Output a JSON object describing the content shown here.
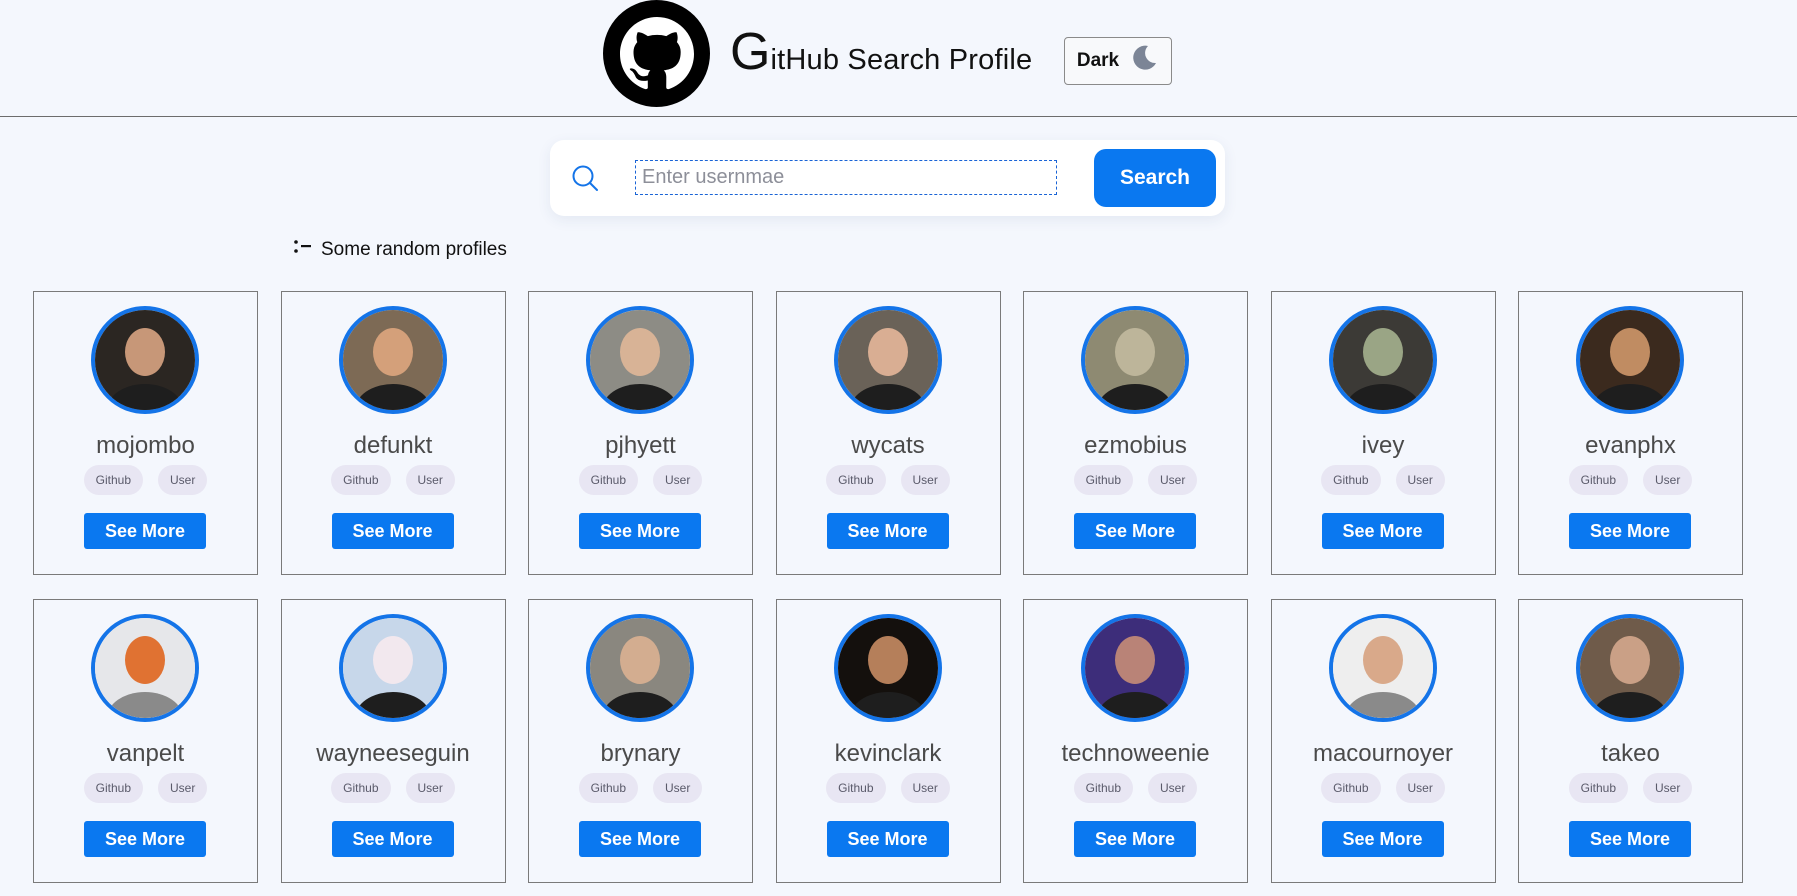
{
  "header": {
    "logo_icon": "github-octocat-icon",
    "title_first": "G",
    "title_rest": "itHub Search Profile",
    "theme_button_label": "Dark",
    "theme_icon": "moon-icon"
  },
  "search": {
    "icon": "search-icon",
    "placeholder": "Enter usernmae",
    "value": "",
    "button_label": "Search"
  },
  "random": {
    "icon": "list-icon",
    "label": "Some random profiles"
  },
  "colors": {
    "accent": "#0a78f0",
    "avatar_ring": "#1474e8",
    "badge_bg": "#e8e6f3",
    "page_bg": "#f4f7fd"
  },
  "profiles": [
    {
      "username": "mojombo",
      "badges": [
        "Github",
        "User"
      ],
      "button": "See More",
      "avatar_bg": "#2b2622",
      "avatar_fg": "#c79778"
    },
    {
      "username": "defunkt",
      "badges": [
        "Github",
        "User"
      ],
      "button": "See More",
      "avatar_bg": "#7d6a55",
      "avatar_fg": "#d4a07a"
    },
    {
      "username": "pjhyett",
      "badges": [
        "Github",
        "User"
      ],
      "button": "See More",
      "avatar_bg": "#8d8c85",
      "avatar_fg": "#d8b396"
    },
    {
      "username": "wycats",
      "badges": [
        "Github",
        "User"
      ],
      "button": "See More",
      "avatar_bg": "#6a6258",
      "avatar_fg": "#d9ae93"
    },
    {
      "username": "ezmobius",
      "badges": [
        "Github",
        "User"
      ],
      "button": "See More",
      "avatar_bg": "#8e8a72",
      "avatar_fg": "#bdb59a"
    },
    {
      "username": "ivey",
      "badges": [
        "Github",
        "User"
      ],
      "button": "See More",
      "avatar_bg": "#3c3a36",
      "avatar_fg": "#9aa585"
    },
    {
      "username": "evanphx",
      "badges": [
        "Github",
        "User"
      ],
      "button": "See More",
      "avatar_bg": "#3b2a1e",
      "avatar_fg": "#c08c62"
    },
    {
      "username": "vanpelt",
      "badges": [
        "Github",
        "User"
      ],
      "button": "See More",
      "avatar_bg": "#e6e7ea",
      "avatar_fg": "#e07232"
    },
    {
      "username": "wayneeseguin",
      "badges": [
        "Github",
        "User"
      ],
      "button": "See More",
      "avatar_bg": "#c7d7ea",
      "avatar_fg": "#f2e8ee"
    },
    {
      "username": "brynary",
      "badges": [
        "Github",
        "User"
      ],
      "button": "See More",
      "avatar_bg": "#8a877f",
      "avatar_fg": "#d3ad90"
    },
    {
      "username": "kevinclark",
      "badges": [
        "Github",
        "User"
      ],
      "button": "See More",
      "avatar_bg": "#14100d",
      "avatar_fg": "#b57f5a"
    },
    {
      "username": "technoweenie",
      "badges": [
        "Github",
        "User"
      ],
      "button": "See More",
      "avatar_bg": "#3d2d7a",
      "avatar_fg": "#b98377"
    },
    {
      "username": "macournoyer",
      "badges": [
        "Github",
        "User"
      ],
      "button": "See More",
      "avatar_bg": "#eeeeee",
      "avatar_fg": "#d9a98a"
    },
    {
      "username": "takeo",
      "badges": [
        "Github",
        "User"
      ],
      "button": "See More",
      "avatar_bg": "#6f5b4a",
      "avatar_fg": "#caa086"
    }
  ]
}
